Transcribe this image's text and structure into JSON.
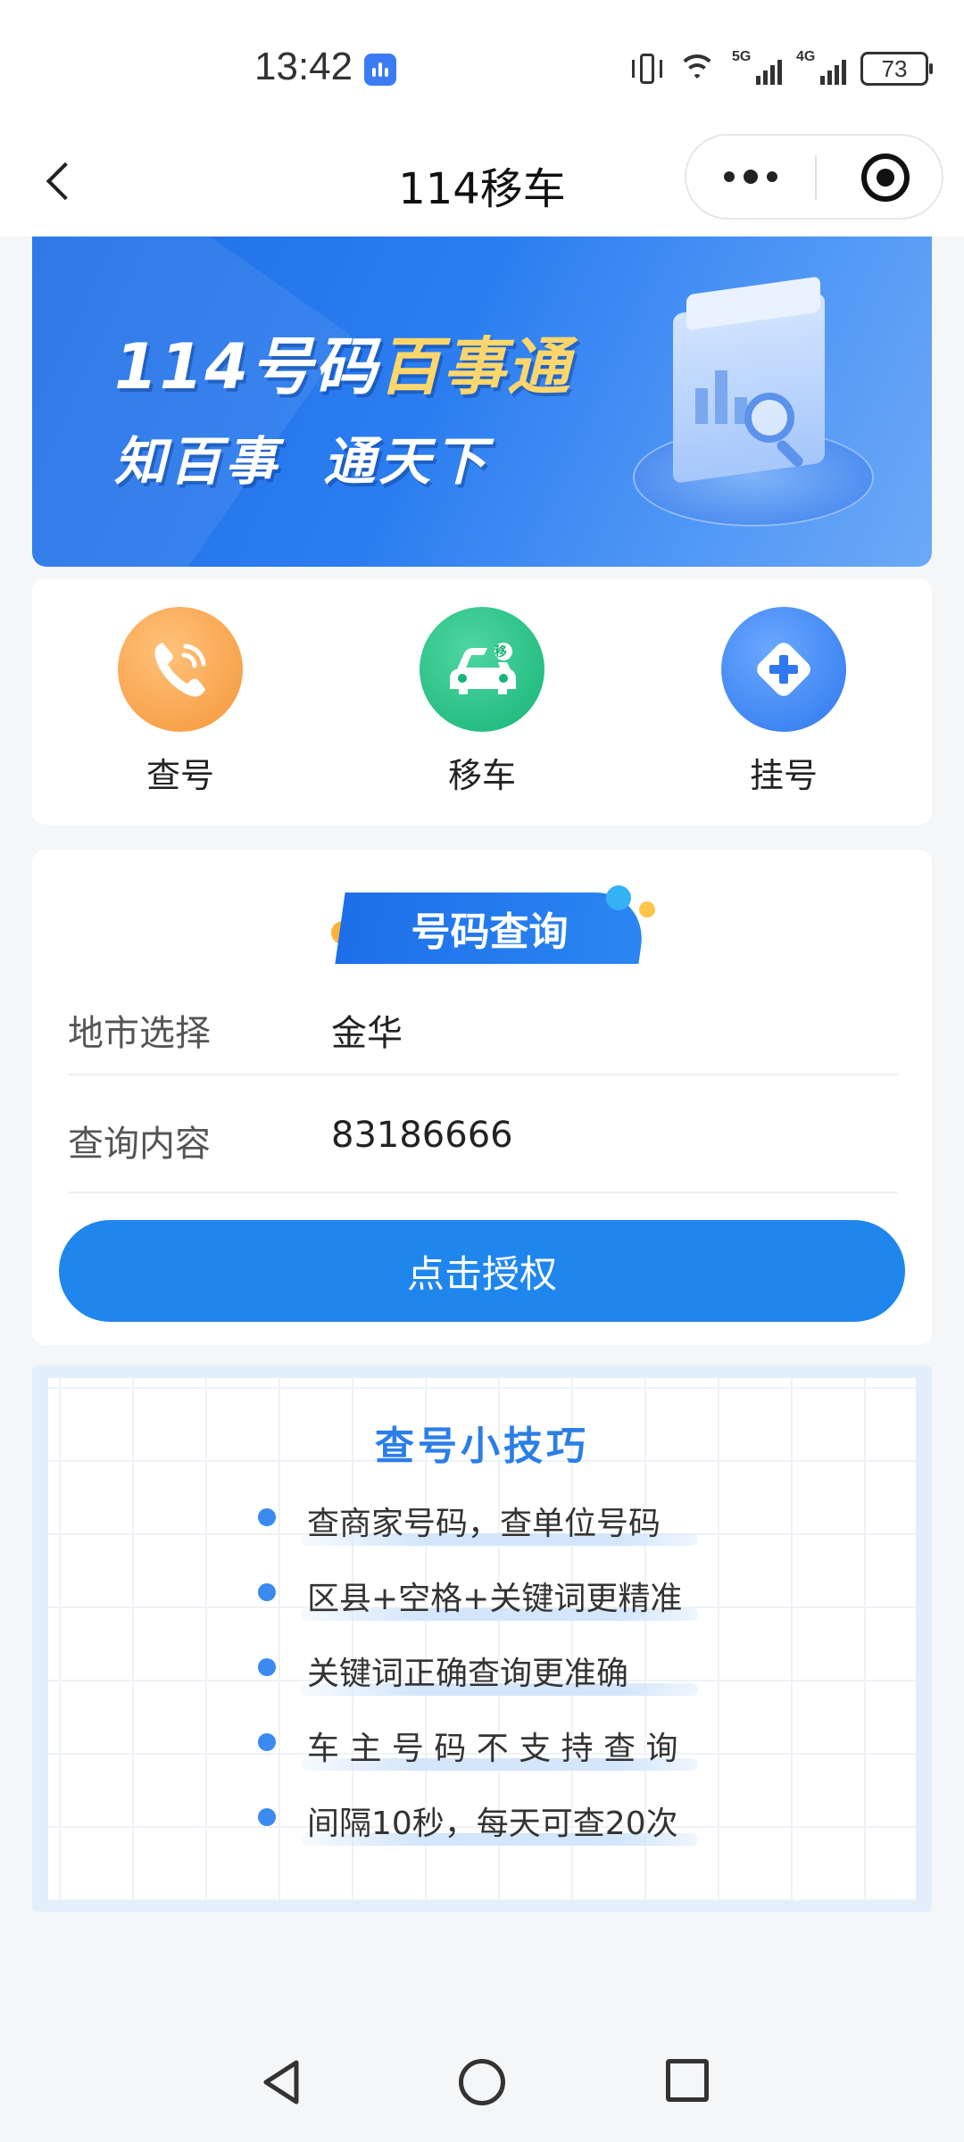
{
  "status_bar": {
    "time": "13:42",
    "signal_1_label": "5G",
    "signal_2_label": "4G",
    "battery": "73",
    "icons": [
      "voice-assistant-icon",
      "vibrate-icon",
      "wifi-icon",
      "signal-icon",
      "battery-icon"
    ]
  },
  "title_bar": {
    "title": "114移车",
    "icons": [
      "back-icon",
      "more-icon",
      "close-mini-program-icon"
    ]
  },
  "banner": {
    "line1_prefix": "114号码",
    "line1_highlight": "百事通",
    "line2": "知百事  通天下",
    "highlight_color": "#ffd66b"
  },
  "actions": [
    {
      "label": "查号",
      "icon": "phone-icon",
      "color": "#f5963a"
    },
    {
      "label": "移车",
      "icon": "car-icon",
      "color": "#17b577"
    },
    {
      "label": "挂号",
      "icon": "medical-plus-icon",
      "color": "#2f78ee"
    }
  ],
  "car_badge": "移",
  "query": {
    "tag": "号码查询",
    "fields": [
      {
        "label": "地市选择",
        "value": "金华"
      },
      {
        "label": "查询内容",
        "value": "83186666"
      }
    ],
    "button": "点击授权",
    "button_color": "#1f86ee"
  },
  "tips": {
    "title": "查号小技巧",
    "items": [
      "查商家号码，查单位号码",
      "区县+空格+关键词更精准",
      "关键词正确查询更准确",
      "车 主 号 码 不 支 持 查 询",
      "间隔10秒，每天可查20次"
    ]
  },
  "nav_bar": {
    "icons": [
      "nav-back-icon",
      "nav-home-icon",
      "nav-recent-icon"
    ]
  }
}
